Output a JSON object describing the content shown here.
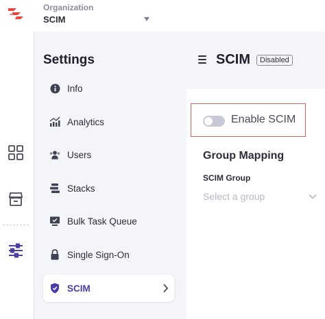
{
  "org": {
    "label": "Organization",
    "value": "SCIM"
  },
  "settings": {
    "title": "Settings",
    "items": [
      {
        "label": "Info",
        "icon": "info-icon"
      },
      {
        "label": "Analytics",
        "icon": "analytics-icon"
      },
      {
        "label": "Users",
        "icon": "users-icon"
      },
      {
        "label": "Stacks",
        "icon": "stacks-icon"
      },
      {
        "label": "Bulk Task Queue",
        "icon": "monitor-icon"
      },
      {
        "label": "Single Sign-On",
        "icon": "lock-icon"
      },
      {
        "label": "SCIM",
        "icon": "shield-icon",
        "active": true
      }
    ]
  },
  "main": {
    "title": "SCIM",
    "badge": "Disabled",
    "toggle": {
      "label": "Enable SCIM",
      "state": "off"
    },
    "group_mapping": {
      "title": "Group Mapping",
      "field_label": "SCIM Group",
      "placeholder": "Select a group"
    }
  },
  "colors": {
    "accent": "#4a3fa8",
    "brand": "#e8453c",
    "highlight_border": "#c8625a"
  }
}
